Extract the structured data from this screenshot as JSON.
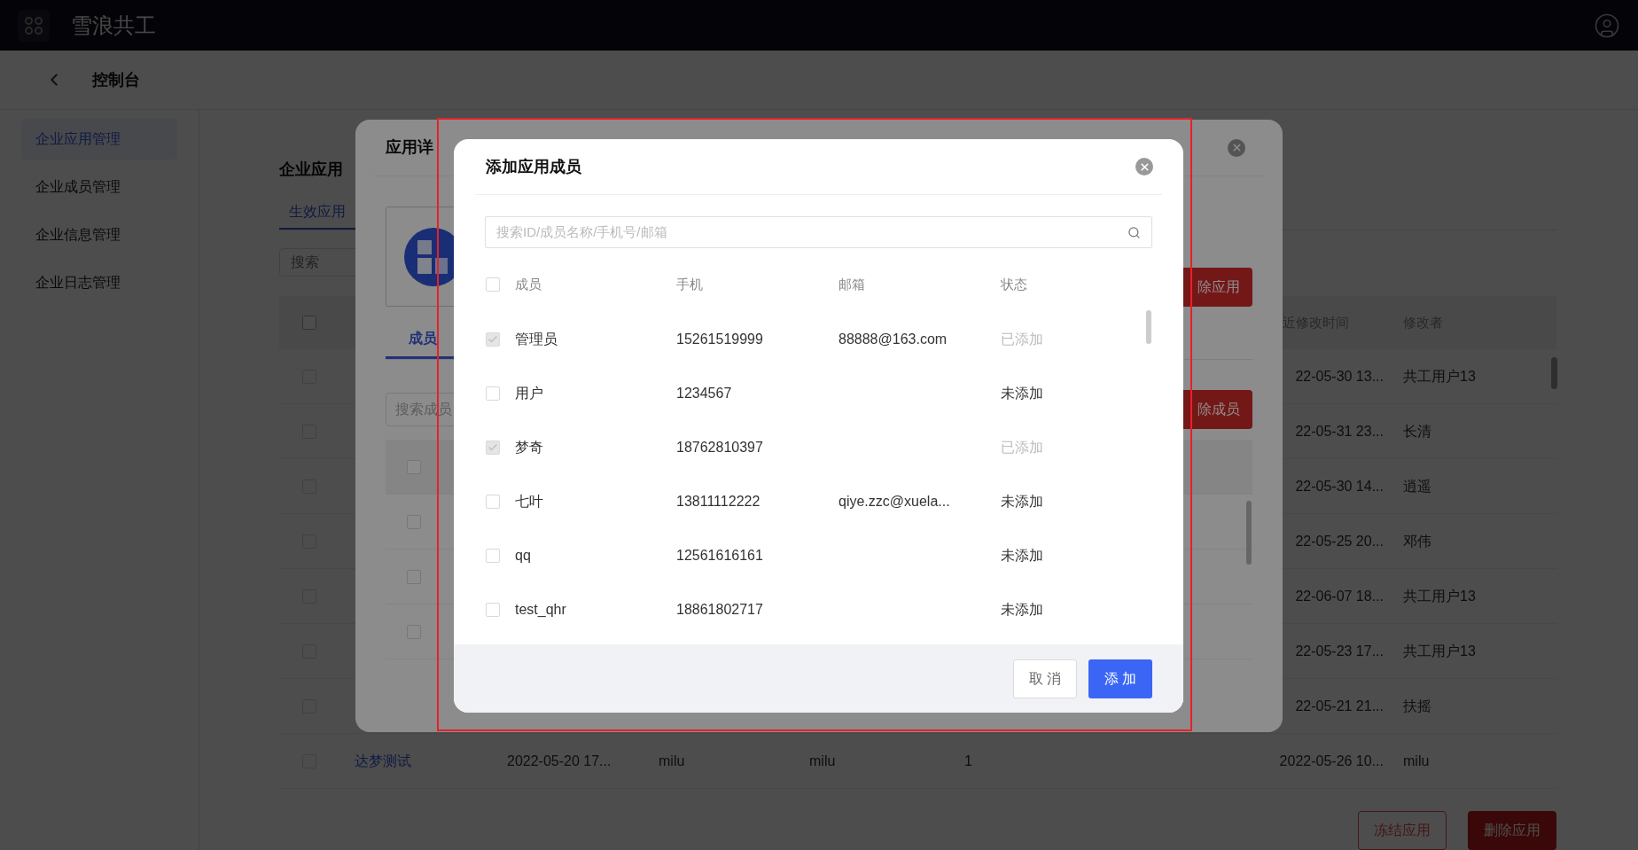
{
  "top_bar": {
    "title": "雪浪共工"
  },
  "sub_header": {
    "title": "控制台"
  },
  "sidebar": {
    "items": [
      {
        "label": "企业应用管理",
        "selected": true
      },
      {
        "label": "企业成员管理",
        "selected": false
      },
      {
        "label": "企业信息管理",
        "selected": false
      },
      {
        "label": "企业日志管理",
        "selected": false
      }
    ]
  },
  "app_management": {
    "title": "企业应用",
    "tabs": [
      {
        "label": "生效应用",
        "selected": true
      }
    ],
    "search": {
      "placeholder": "搜索"
    },
    "table": {
      "header_checked": false,
      "columns": [
        "近修改时间",
        "修改者"
      ],
      "rows": [
        {
          "checked": false,
          "modified_time": "22-05-30 13...",
          "modifier": "共工用户13"
        },
        {
          "checked": false,
          "modified_time": "22-05-31 23...",
          "modifier": "长清"
        },
        {
          "checked": false,
          "modified_time": "22-05-30 14...",
          "modifier": "逍遥"
        },
        {
          "checked": false,
          "modified_time": "22-05-25 20...",
          "modifier": "邓伟"
        },
        {
          "checked": false,
          "modified_time": "22-06-07 18...",
          "modifier": "共工用户13"
        },
        {
          "checked": false,
          "modified_time": "22-05-23 17...",
          "modifier": "共工用户13"
        },
        {
          "checked": false,
          "modified_time": "22-05-21 21...",
          "modifier": "扶摇"
        },
        {
          "checked": false,
          "name": "达梦测试",
          "created": "2022-05-20 17...",
          "creator": "milu",
          "editor": "milu",
          "count": "1",
          "modified_time": "2022-05-26 10...",
          "modifier": "milu"
        }
      ]
    },
    "buttons": [
      {
        "label": "冻结应用",
        "kind": "outline"
      },
      {
        "label": "删除应用",
        "kind": "danger"
      }
    ]
  },
  "app_detail_dialog": {
    "title": "应用详",
    "tabs": [
      {
        "label": "成员",
        "selected": true
      }
    ],
    "delete_app_button": "除应用",
    "delete_member_button": "除成员",
    "member_search": {
      "placeholder": "搜索成员"
    },
    "member_rows": [
      {
        "checked": false
      },
      {
        "checked": false
      },
      {
        "checked": false
      },
      {
        "checked": false
      }
    ]
  },
  "add_member_dialog": {
    "title": "添加应用成员",
    "search": {
      "placeholder": "搜索ID/成员名称/手机号/邮箱"
    },
    "columns": [
      "成员",
      "手机",
      "邮箱",
      "状态"
    ],
    "header_checked": false,
    "rows": [
      {
        "name": "管理员",
        "phone": "15261519999",
        "email": "88888@163.com",
        "status": "已添加",
        "added": true,
        "checked": true
      },
      {
        "name": "用户",
        "phone": "1234567",
        "status": "未添加",
        "added": false,
        "checked": false
      },
      {
        "name": "梦奇",
        "phone": "18762810397",
        "status": "已添加",
        "added": true,
        "checked": true
      },
      {
        "name": "七叶",
        "phone": "13811112222",
        "email": "qiye.zzc@xuela...",
        "status": "未添加",
        "added": false,
        "checked": false
      },
      {
        "name": "qq",
        "phone": "12561616161",
        "status": "未添加",
        "added": false,
        "checked": false
      },
      {
        "name": "test_qhr",
        "phone": "18861802717",
        "status": "未添加",
        "added": false,
        "checked": false
      }
    ],
    "buttons": [
      {
        "label": "取 消",
        "kind": "secondary"
      },
      {
        "label": "添 加",
        "kind": "primary"
      }
    ]
  }
}
